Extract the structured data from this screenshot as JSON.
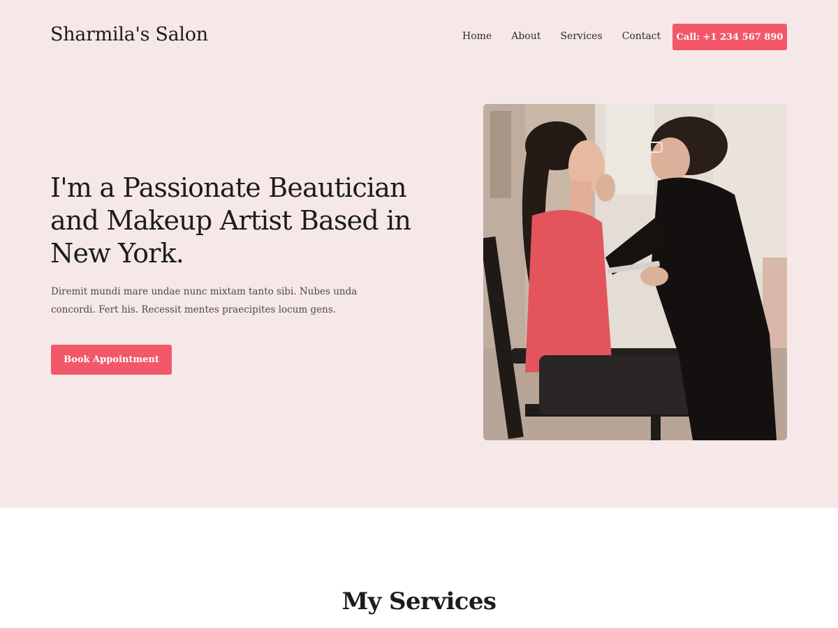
{
  "header": {
    "site_title": "Sharmila's Salon",
    "nav": [
      {
        "label": "Home"
      },
      {
        "label": "About"
      },
      {
        "label": "Services"
      },
      {
        "label": "Contact"
      }
    ],
    "call_button": "Call: +1 234 567 890"
  },
  "hero": {
    "headline": "I'm a Passionate Beautician and Makeup Artist Based in New York.",
    "lead": "Diremit mundi mare undae nunc mixtam tanto sibi. Nubes unda concordi. Fert his. Recessit mentes praecipites locum gens.",
    "cta": "Book Appointment",
    "image_alt": "makeup-artist-photo"
  },
  "services": {
    "title": "My Services"
  },
  "colors": {
    "hero_bg": "#f6e8e8",
    "accent": "#f3586a",
    "text": "#1c1c1c"
  }
}
